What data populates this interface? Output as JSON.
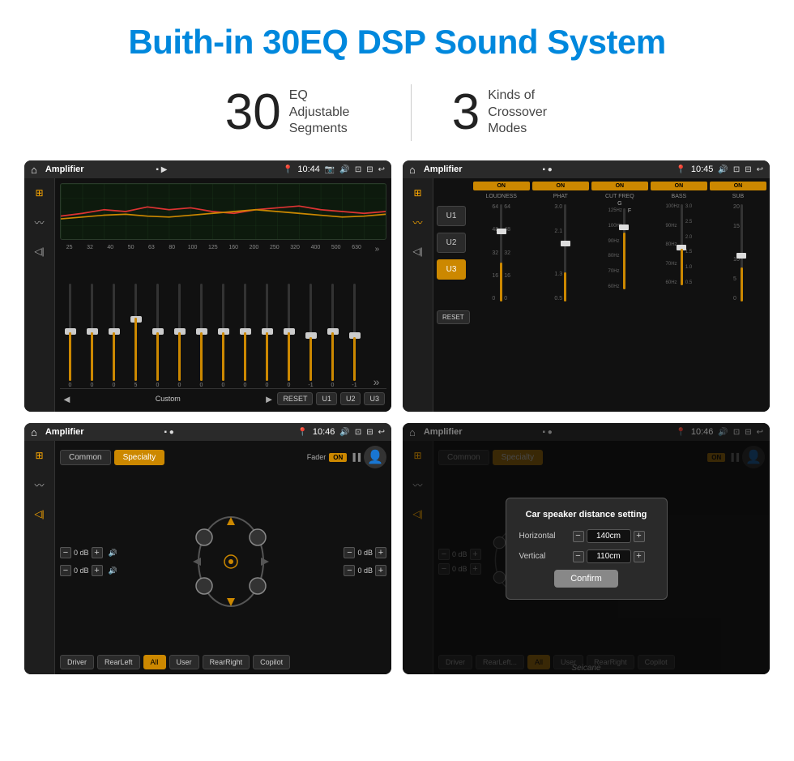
{
  "page": {
    "title": "Buith-in 30EQ DSP Sound System",
    "stat1_number": "30",
    "stat1_label": "EQ Adjustable\nSegments",
    "stat2_number": "3",
    "stat2_label": "Kinds of\nCrossover Modes"
  },
  "screens": {
    "screen1": {
      "title": "Amplifier",
      "time": "10:44",
      "eq_labels": [
        "25",
        "32",
        "40",
        "50",
        "63",
        "80",
        "100",
        "125",
        "160",
        "200",
        "250",
        "320",
        "400",
        "500",
        "630"
      ],
      "fader_values": [
        "0",
        "0",
        "0",
        "0",
        "5",
        "0",
        "0",
        "0",
        "0",
        "0",
        "0",
        "0",
        "0",
        "-1",
        "0",
        "-1"
      ],
      "preset_name": "Custom",
      "buttons": [
        "RESET",
        "U1",
        "U2",
        "U3"
      ]
    },
    "screen2": {
      "title": "Amplifier",
      "time": "10:45",
      "channels": [
        "LOUDNESS",
        "PHAT",
        "CUT FREQ",
        "BASS",
        "SUB"
      ],
      "u_buttons": [
        "U1",
        "U2",
        "U3"
      ],
      "active_u": "U3",
      "reset_label": "RESET"
    },
    "screen3": {
      "title": "Amplifier",
      "time": "10:46",
      "tabs": [
        "Common",
        "Specialty"
      ],
      "active_tab": "Specialty",
      "fader_label": "Fader",
      "on_badge": "ON",
      "db_labels": [
        "0 dB",
        "0 dB",
        "0 dB",
        "0 dB"
      ],
      "position_labels": [
        "Driver",
        "RearLeft",
        "All",
        "User",
        "RearRight",
        "Copilot"
      ]
    },
    "screen4": {
      "title": "Amplifier",
      "time": "10:46",
      "tabs": [
        "Common",
        "Specialty"
      ],
      "active_tab": "Specialty",
      "on_badge": "ON",
      "dialog": {
        "title": "Car speaker distance setting",
        "horizontal_label": "Horizontal",
        "horizontal_value": "140cm",
        "vertical_label": "Vertical",
        "vertical_value": "110cm",
        "confirm_label": "Confirm"
      },
      "db_labels": [
        "0 dB",
        "0 dB"
      ],
      "position_labels": [
        "Driver",
        "RearLeft..",
        "All",
        "User",
        "RearRight",
        "Copilot"
      ]
    }
  },
  "watermark": "Seicane"
}
